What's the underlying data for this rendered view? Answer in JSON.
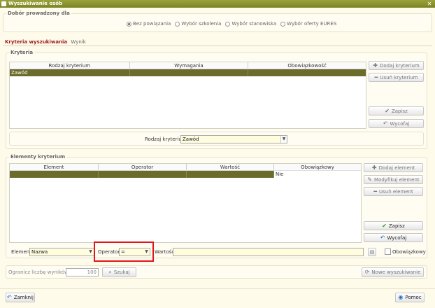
{
  "window": {
    "title": "Wyszukiwanie osób"
  },
  "dobor": {
    "legend": "Dobór prowadzony dla",
    "options": [
      {
        "label": "Bez powiązania",
        "selected": true
      },
      {
        "label": "Wybór szkolenia",
        "selected": false
      },
      {
        "label": "Wybór stanowiska",
        "selected": false
      },
      {
        "label": "Wybór oferty EURES",
        "selected": false
      }
    ]
  },
  "tabs": {
    "active": "Kryteria wyszukiwania",
    "other": "Wynik"
  },
  "kryteria": {
    "legend": "Kryteria",
    "columns": [
      "Rodzaj kryterium",
      "Wymagania",
      "Obowiązkowość"
    ],
    "rows": [
      [
        "Zawód",
        "",
        ""
      ]
    ],
    "buttons": {
      "add": "Dodaj kryterium",
      "remove": "Usuń kryterium",
      "save": "Zapisz",
      "revert": "Wycofaj"
    },
    "rodzaj_label": "Rodzaj kryterium",
    "rodzaj_value": "Zawód"
  },
  "elementy": {
    "legend": "Elementy kryterium",
    "columns": [
      "Element",
      "Operator",
      "Wartość",
      "Obowiązkowy"
    ],
    "rows": [
      [
        "",
        "",
        "",
        "Nie"
      ]
    ],
    "buttons": {
      "add": "Dodaj element",
      "modify": "Modyfikuj element",
      "remove": "Usuń element",
      "save": "Zapisz",
      "revert": "Wycofaj"
    },
    "element_label": "Element",
    "element_value": "Nazwa",
    "operator_label": "Operator",
    "operator_value": "=",
    "wartosc_label": "Wartość",
    "obowiazkowy_label": "Obowiązkowy"
  },
  "limit": {
    "label": "Ogranicz liczbę wyników do",
    "value": "100",
    "search": "Szukaj",
    "new_search": "Nowe wyszukiwanie"
  },
  "footer": {
    "close": "Zamknij",
    "help": "Pomoc"
  },
  "colors": {
    "title": "#7b8426",
    "selected_row": "#6b6b2c",
    "tab_active": "#9b1b1b",
    "highlight": "#e0161f"
  }
}
